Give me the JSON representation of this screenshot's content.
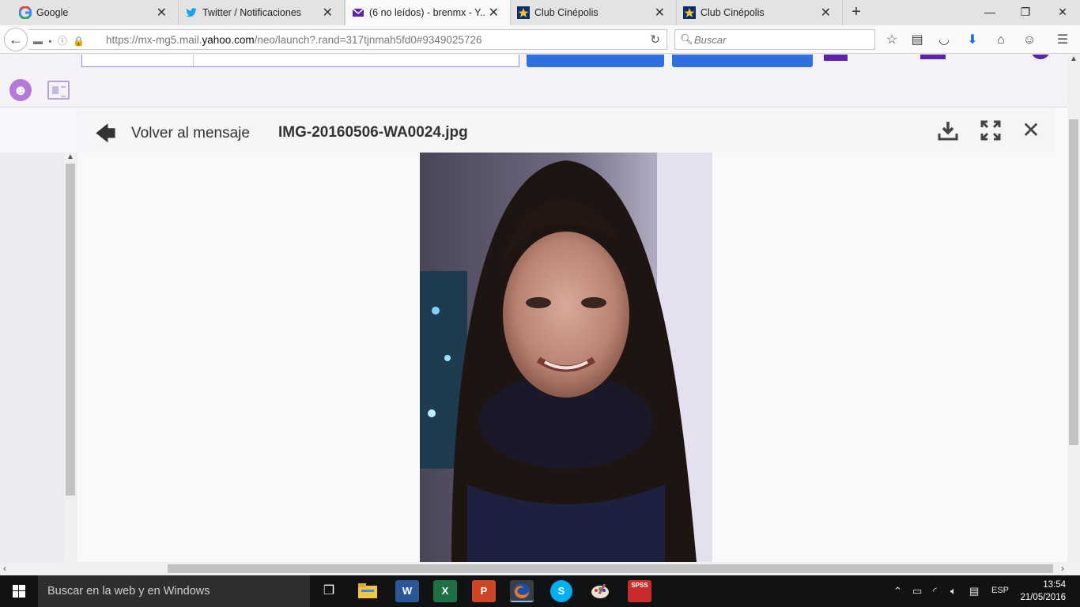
{
  "browser": {
    "tabs": [
      {
        "title": "Google",
        "favicon": "google-icon",
        "active": false
      },
      {
        "title": "Twitter / Notificaciones",
        "favicon": "twitter-icon",
        "active": false
      },
      {
        "title": "(6 no leídos) - brenmx - Y...",
        "favicon": "yahoo-mail-icon",
        "active": true
      },
      {
        "title": "Club Cinépolis",
        "favicon": "cinepolis-icon",
        "active": false
      },
      {
        "title": "Club Cinépolis",
        "favicon": "cinepolis-icon",
        "active": false
      }
    ],
    "new_tab": "+",
    "window_controls": {
      "minimize": "—",
      "restore": "❐",
      "close": "✕"
    },
    "url_prefix": "https://mx-mg5.mail.",
    "url_domain": "yahoo.com",
    "url_suffix": "/neo/launch?.rand=317tjnmah5fd0#9349025726",
    "search_placeholder": "Buscar"
  },
  "mail": {
    "back_label": "Volver al mensaje",
    "filename": "IMG-20160506-WA0024.jpg",
    "accent": "#5b24a8",
    "button_color": "#2f6fe0"
  },
  "taskbar": {
    "search_placeholder": "Buscar en la web y en Windows",
    "apps": [
      {
        "name": "task-view-icon",
        "label": "❐"
      },
      {
        "name": "file-explorer-icon",
        "label": ""
      },
      {
        "name": "word-icon",
        "label": "W"
      },
      {
        "name": "excel-icon",
        "label": "X"
      },
      {
        "name": "powerpoint-icon",
        "label": "P"
      },
      {
        "name": "firefox-icon",
        "label": ""
      },
      {
        "name": "skype-icon",
        "label": "S"
      },
      {
        "name": "paint-icon",
        "label": ""
      },
      {
        "name": "spss-icon",
        "label": "SPSS"
      }
    ],
    "language": "ESP",
    "time": "13:54",
    "date": "21/05/2016"
  }
}
